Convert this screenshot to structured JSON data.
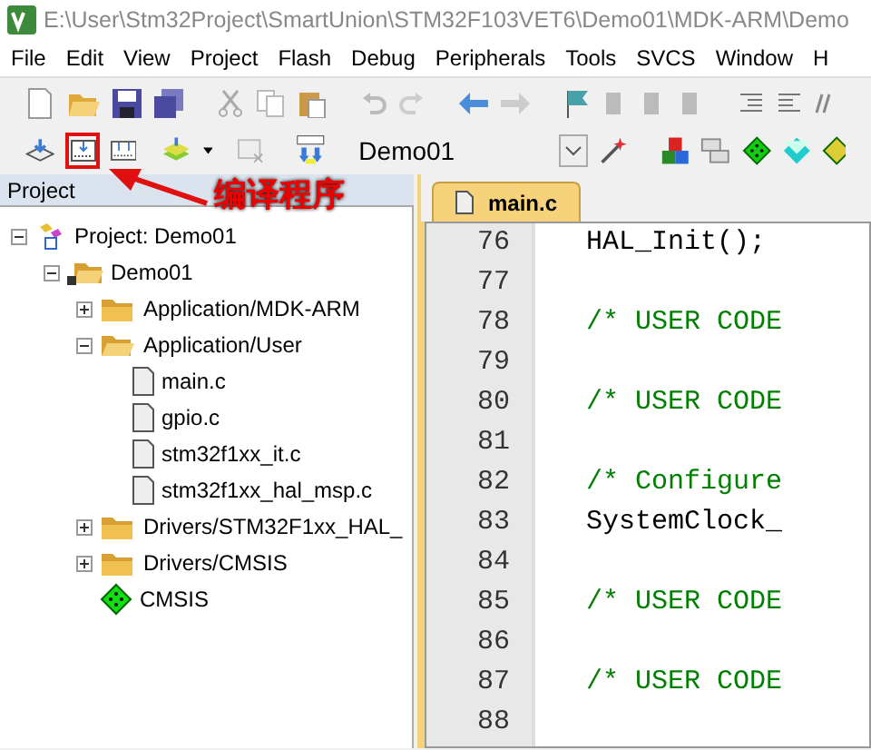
{
  "window": {
    "title": "E:\\User\\Stm32Project\\SmartUnion\\STM32F103VET6\\Demo01\\MDK-ARM\\Demo"
  },
  "menu": [
    "File",
    "Edit",
    "View",
    "Project",
    "Flash",
    "Debug",
    "Peripherals",
    "Tools",
    "SVCS",
    "Window",
    "H"
  ],
  "target": {
    "value": "Demo01"
  },
  "annotation": {
    "text": "编译程序"
  },
  "project_panel": {
    "title": "Project",
    "tree": [
      {
        "label": "Project: Demo01",
        "kind": "project",
        "expanded": true,
        "children": [
          {
            "label": "Demo01",
            "kind": "target",
            "expanded": true,
            "children": [
              {
                "label": "Application/MDK-ARM",
                "kind": "group",
                "expanded": false
              },
              {
                "label": "Application/User",
                "kind": "group",
                "expanded": true,
                "children": [
                  {
                    "label": "main.c",
                    "kind": "file"
                  },
                  {
                    "label": "gpio.c",
                    "kind": "file"
                  },
                  {
                    "label": "stm32f1xx_it.c",
                    "kind": "file"
                  },
                  {
                    "label": "stm32f1xx_hal_msp.c",
                    "kind": "file"
                  }
                ]
              },
              {
                "label": "Drivers/STM32F1xx_HAL_",
                "kind": "group",
                "expanded": false
              },
              {
                "label": "Drivers/CMSIS",
                "kind": "group",
                "expanded": false
              },
              {
                "label": "CMSIS",
                "kind": "component"
              }
            ]
          }
        ]
      }
    ]
  },
  "editor": {
    "tabs": [
      {
        "label": "main.c",
        "selected": true
      }
    ],
    "lines": [
      {
        "number": "76",
        "code": "HAL_Init();",
        "kind": "code"
      },
      {
        "number": "77"
      },
      {
        "number": "78",
        "code": "/* USER CODE",
        "kind": "comment"
      },
      {
        "number": "79"
      },
      {
        "number": "80",
        "code": "/* USER CODE",
        "kind": "comment"
      },
      {
        "number": "81"
      },
      {
        "number": "82",
        "code": "/* Configure",
        "kind": "comment"
      },
      {
        "number": "83",
        "code": "SystemClock_",
        "kind": "code"
      },
      {
        "number": "84"
      },
      {
        "number": "85",
        "code": "/* USER CODE",
        "kind": "comment"
      },
      {
        "number": "86"
      },
      {
        "number": "87",
        "code": "/* USER CODE",
        "kind": "comment"
      },
      {
        "number": "88"
      }
    ]
  }
}
